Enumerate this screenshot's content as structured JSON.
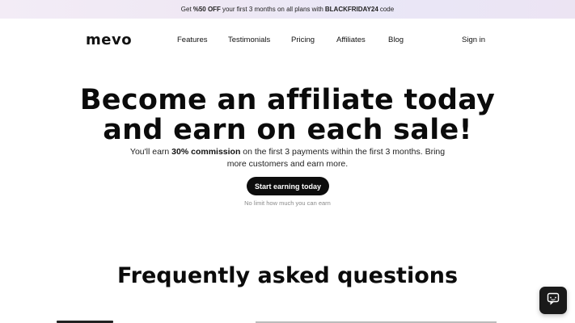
{
  "promo": {
    "text_1": "Get",
    "discount": "%50 OFF",
    "text_2": "your first 3 months on all plans with",
    "code": "BLACKFRIDAY24",
    "text_3": "code"
  },
  "nav": {
    "logo": "mevo",
    "links": [
      "Features",
      "Testimonials",
      "Pricing",
      "Affiliates",
      "Blog"
    ],
    "sign_in": "Sign in"
  },
  "hero": {
    "title_line_1": "Become an affiliate today",
    "title_line_2": "and earn on each sale!",
    "subtitle_1": "You'll earn",
    "subtitle_bold": "30% commission",
    "subtitle_2": "on the first 3 payments within the first 3 months. Bring more customers and earn more.",
    "cta_label": "Start earning today",
    "cta_note": "No limit how much you can earn"
  },
  "faq": {
    "title": "Frequently asked questions"
  },
  "icons": {
    "chat": "chat-bubble-icon"
  }
}
